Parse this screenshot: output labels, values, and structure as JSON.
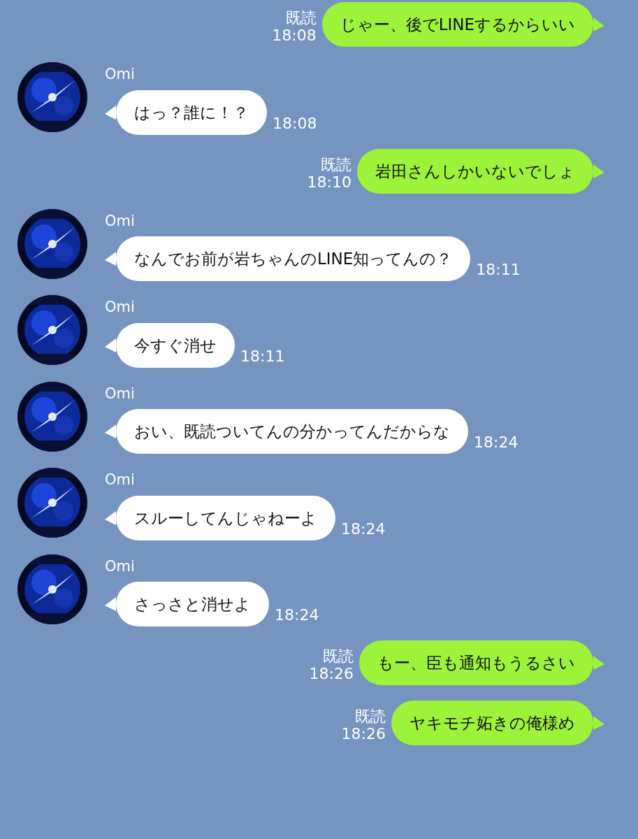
{
  "messages": [
    {
      "kind": "out",
      "read_label": "既読",
      "text": "じゃー、後でLINEするからいい",
      "time": "18:08"
    },
    {
      "kind": "in",
      "sender": "Omi",
      "text": "はっ？誰に！？",
      "time": "18:08"
    },
    {
      "kind": "out",
      "read_label": "既読",
      "text": "岩田さんしかいないでしょ",
      "time": "18:10"
    },
    {
      "kind": "in",
      "sender": "Omi",
      "text": "なんでお前が岩ちゃんのLINE知ってんの？",
      "time": "18:11"
    },
    {
      "kind": "in",
      "sender": "Omi",
      "text": "今すぐ消せ",
      "time": "18:11"
    },
    {
      "kind": "in",
      "sender": "Omi",
      "text": "おい、既読ついてんの分かってんだからな",
      "time": "18:24"
    },
    {
      "kind": "in",
      "sender": "Omi",
      "text": "スルーしてんじゃねーよ",
      "time": "18:24"
    },
    {
      "kind": "in",
      "sender": "Omi",
      "text": "さっさと消せよ",
      "time": "18:24"
    },
    {
      "kind": "out",
      "read_label": "既読",
      "text": "もー、臣も通知もうるさい",
      "time": "18:26"
    },
    {
      "kind": "out",
      "read_label": "既読",
      "text": "ヤキモチ妬きの俺様め",
      "time": "18:26"
    }
  ]
}
